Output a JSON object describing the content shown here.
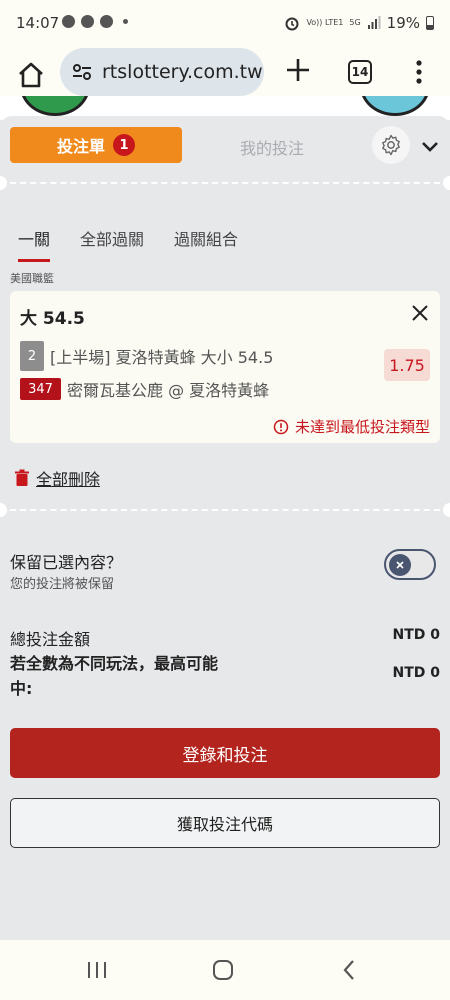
{
  "status_bar": {
    "time": "14:07",
    "network_top": "Vo)) LTE1",
    "signal_type": "5G",
    "battery": "19%"
  },
  "browser": {
    "url": "rtslottery.com.tw",
    "tab_count": "14"
  },
  "betslip": {
    "tab_betslip": "投注單",
    "tab_betslip_count": "1",
    "tab_mybets": "我的投注",
    "subtabs": [
      "一關",
      "全部過關",
      "過關組合"
    ],
    "league": "美國職籃",
    "selection": {
      "title": "大 54.5",
      "market_num": "2",
      "market_desc": "[上半場] 夏洛特黃蜂 大小 54.5",
      "event_code": "347",
      "event_desc": "密爾瓦基公鹿 @ 夏洛特黃蜂",
      "odds": "1.75",
      "warning": "未達到最低投注類型"
    },
    "delete_all": "全部刪除",
    "keep": {
      "title": "保留已選內容？",
      "subtitle": "您的投注將被保留"
    },
    "total_label": "總投注金額",
    "total_value": "NTD 0",
    "max_label": "若全數為不同玩法，最高可能中:",
    "max_value": "NTD 0",
    "login_button": "登錄和投注",
    "code_button": "獲取投注代碼"
  },
  "colors": {
    "accent_orange": "#f08a1c",
    "brand_red": "#b3241e",
    "warning_red": "#c8161d"
  }
}
